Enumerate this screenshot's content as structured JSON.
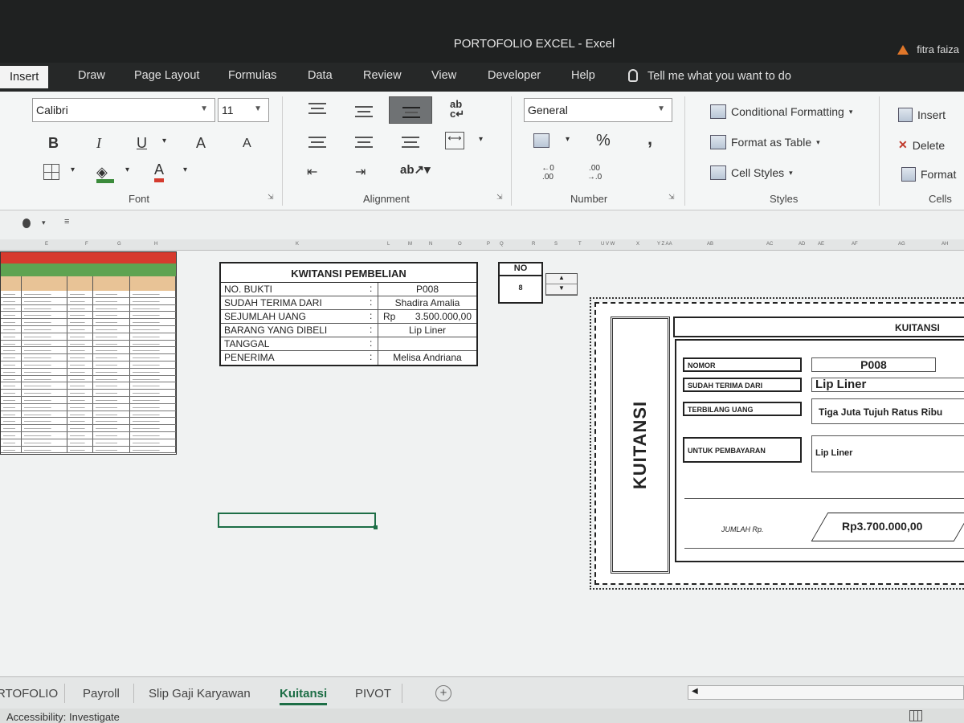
{
  "window": {
    "title": "PORTOFOLIO EXCEL  -  Excel",
    "user": "fitra faiza"
  },
  "menu": {
    "active": "Insert",
    "tabs": [
      "Draw",
      "Page Layout",
      "Formulas",
      "Data",
      "Review",
      "View",
      "Developer",
      "Help"
    ],
    "tell_me": "Tell me what you want to do"
  },
  "ribbon": {
    "font": {
      "name": "Calibri",
      "size": "11",
      "label": "Font",
      "bold": "B",
      "italic": "I",
      "underline": "U",
      "grow": "A",
      "shrink": "A",
      "font_color": "A"
    },
    "alignment": {
      "label": "Alignment",
      "wrap": "ab"
    },
    "number": {
      "format": "General",
      "label": "Number",
      "percent": "%",
      "comma": ",",
      "inc_decimal": "←0 .00",
      "dec_decimal": ".00 →.0"
    },
    "styles": {
      "label": "Styles",
      "conditional": "Conditional Formatting",
      "format_table": "Format as Table",
      "cell_styles": "Cell Styles"
    },
    "cells": {
      "label": "Cells",
      "insert": "Insert",
      "delete": "Delete",
      "format": "Format"
    }
  },
  "form": {
    "title": "KWITANSI PEMBELIAN",
    "rows": [
      {
        "label": "NO. BUKTI",
        "colon": ":",
        "value": "P008"
      },
      {
        "label": "SUDAH TERIMA DARI",
        "colon": ":",
        "value": "Shadira Amalia"
      },
      {
        "label": "SEJUMLAH UANG",
        "colon": ":",
        "currency": "Rp",
        "value": "3.500.000,00"
      },
      {
        "label": "BARANG YANG DIBELI",
        "colon": ":",
        "value": "Lip Liner"
      },
      {
        "label": "TANGGAL",
        "colon": ":",
        "value": ""
      },
      {
        "label": "PENERIMA",
        "colon": ":",
        "value": "Melisa Andriana"
      }
    ]
  },
  "no_box": {
    "label": "NO",
    "value": "8",
    "up": "▲",
    "down": "▼"
  },
  "receipt": {
    "side_title": "KUITANSI",
    "header": "KUITANSI",
    "nomor_label": "NOMOR",
    "nomor_value": "P008",
    "terima_label": "SUDAH TERIMA DARI",
    "terima_value": "Lip Liner",
    "terbilang_label": "TERBILANG UANG",
    "terbilang_value": "Tiga Juta Tujuh Ratus Ribu",
    "untuk_label": "UNTUK PEMBAYARAN",
    "untuk_value": "Lip Liner",
    "jumlah_label": "JUMLAH Rp.",
    "jumlah_value": "Rp3.700.000,00"
  },
  "sheet_tabs": [
    {
      "label": "RTOFOLIO",
      "active": false
    },
    {
      "label": "Payroll",
      "active": false
    },
    {
      "label": "Slip Gaji Karyawan",
      "active": false
    },
    {
      "label": "Kuitansi",
      "active": true
    },
    {
      "label": "PIVOT",
      "active": false
    }
  ],
  "status": {
    "text": "Accessibility: Investigate"
  },
  "colors": {
    "accent": "#1d6e46",
    "title_bar": "#1f2121",
    "red_header": "#d63a2e",
    "green_header": "#5ea351"
  }
}
